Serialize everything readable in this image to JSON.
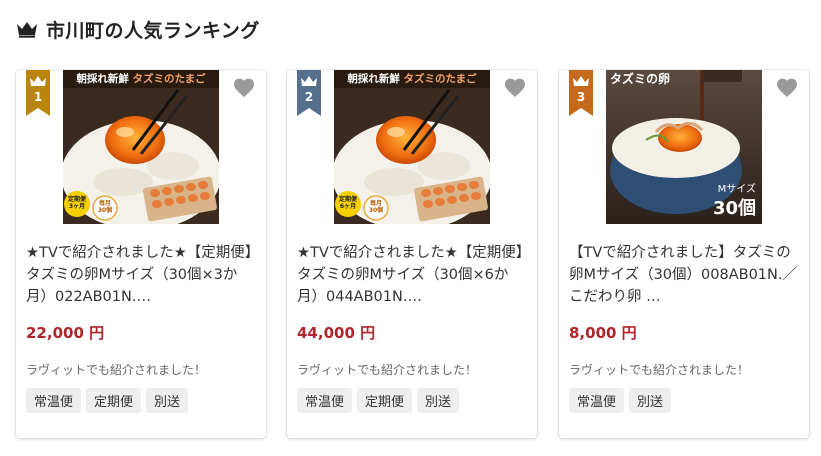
{
  "header": {
    "title": "市川町の人気ランキング"
  },
  "colors": {
    "gold": "#b8860b",
    "steel": "#55708c",
    "bronze": "#c46a1a",
    "price": "#b0242c",
    "heart": "#9a9a9a"
  },
  "items": [
    {
      "rank": "1",
      "banner_main": "朝採れ新鮮",
      "banner_accent": "タズミのたまご",
      "badge_a": "定期便\n3ヶ月",
      "badge_b": "毎月\n30個",
      "name": "★TVで紹介されました★【定期便】タズミの卵Mサイズ（30個×3か月）022AB01N.…",
      "price": "22,000 円",
      "note": "ラヴィットでも紹介されました！",
      "tags": [
        "常温便",
        "定期便",
        "別送"
      ]
    },
    {
      "rank": "2",
      "banner_main": "朝採れ新鮮",
      "banner_accent": "タズミのたまご",
      "badge_a": "定期便\n6ヶ月",
      "badge_b": "毎月\n30個",
      "name": "★TVで紹介されました★【定期便】タズミの卵Mサイズ（30個×6か月）044AB01N.…",
      "price": "44,000 円",
      "note": "ラヴィットでも紹介されました！",
      "tags": [
        "常温便",
        "定期便",
        "別送"
      ]
    },
    {
      "rank": "3",
      "banner_main": "タズミの卵",
      "badge_label": "Mサイズ",
      "badge_count": "30個",
      "name": "【TVで紹介されました】タズミの卵Mサイズ（30個）008AB01N.／こだわり卵 …",
      "price": "8,000 円",
      "note": "ラヴィットでも紹介されました！",
      "tags": [
        "常温便",
        "別送"
      ]
    }
  ]
}
